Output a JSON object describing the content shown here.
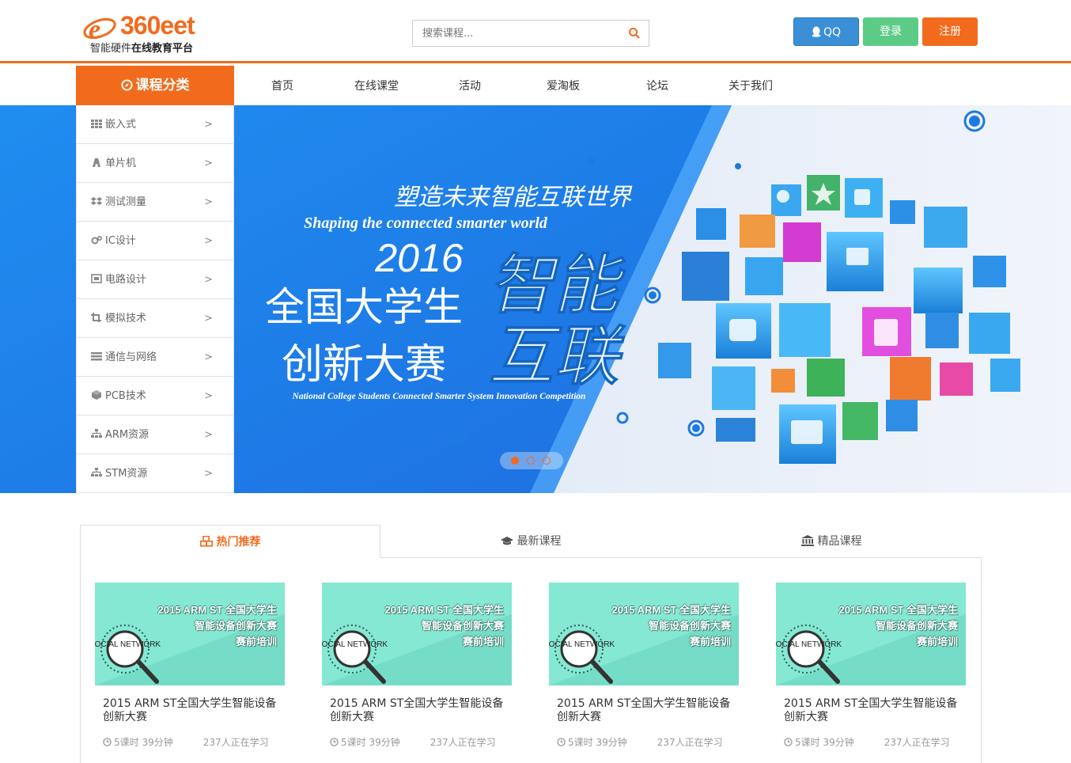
{
  "brand": {
    "logo_text": "360eet",
    "tagline_prefix": "智能硬件",
    "tagline_bold": "在线教育平台",
    "color": "#f26b1d"
  },
  "search": {
    "placeholder": "搜索课程..."
  },
  "header_buttons": {
    "qq": "QQ",
    "login": "登录",
    "register": "注册"
  },
  "category_header": "课程分类",
  "nav": [
    "首页",
    "在线课堂",
    "活动",
    "爱淘板",
    "论坛",
    "关于我们"
  ],
  "sidebar": [
    {
      "label": "嵌入式",
      "icon": "grid-icon"
    },
    {
      "label": "单片机",
      "icon": "chip-icon"
    },
    {
      "label": "测试测量",
      "icon": "dropbox-icon"
    },
    {
      "label": "IC设计",
      "icon": "gears-icon"
    },
    {
      "label": "电路设计",
      "icon": "frame-icon"
    },
    {
      "label": "模拟技术",
      "icon": "crop-icon"
    },
    {
      "label": "通信与网络",
      "icon": "tasks-icon"
    },
    {
      "label": "PCB技术",
      "icon": "cube-icon"
    },
    {
      "label": "ARM资源",
      "icon": "sitemap-icon"
    },
    {
      "label": "STM资源",
      "icon": "sitemap-icon"
    }
  ],
  "sidebar_arrow": ">",
  "banner": {
    "headline_cn": "塑造未来智能互联世界",
    "headline_en": "Shaping the connected smarter world",
    "year": "2016",
    "line1": "全国大学生",
    "line2": "创新大赛",
    "big1": "智能",
    "big2": "互联",
    "subtitle_en": "National College Students Connected Smarter System Innovation Competition",
    "active_slide": 1,
    "slides": 3
  },
  "tabs": [
    {
      "label": "热门推荐",
      "icon": "cubes-icon",
      "active": true
    },
    {
      "label": "最新课程",
      "icon": "graduation-cap-icon",
      "active": false
    },
    {
      "label": "精品课程",
      "icon": "bank-icon",
      "active": false
    }
  ],
  "courses": [
    {
      "thumb_l1": "2015 ARM ST 全国大学生",
      "thumb_l2": "智能设备创新大赛",
      "thumb_l3": "赛前培训",
      "thumb_badge": "SOCIAL NETWORK",
      "title": "2015 ARM ST全国大学生智能设备创新大赛",
      "meta_time": "5课时 39分钟",
      "meta_learners": "237人正在学习"
    },
    {
      "thumb_l1": "2015 ARM ST 全国大学生",
      "thumb_l2": "智能设备创新大赛",
      "thumb_l3": "赛前培训",
      "thumb_badge": "SOCIAL NETWORK",
      "title": "2015 ARM ST全国大学生智能设备创新大赛",
      "meta_time": "5课时 39分钟",
      "meta_learners": "237人正在学习"
    },
    {
      "thumb_l1": "2015 ARM ST 全国大学生",
      "thumb_l2": "智能设备创新大赛",
      "thumb_l3": "赛前培训",
      "thumb_badge": "SOCIAL NETWORK",
      "title": "2015 ARM ST全国大学生智能设备创新大赛",
      "meta_time": "5课时 39分钟",
      "meta_learners": "237人正在学习"
    },
    {
      "thumb_l1": "2015 ARM ST 全国大学生",
      "thumb_l2": "智能设备创新大赛",
      "thumb_l3": "赛前培训",
      "thumb_badge": "SOCIAL NETWORK",
      "title": "2015 ARM ST全国大学生智能设备创新大赛",
      "meta_time": "5课时 39分钟",
      "meta_learners": "237人正在学习"
    }
  ]
}
